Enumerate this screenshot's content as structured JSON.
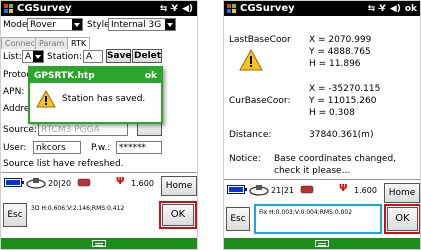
{
  "colors": {
    "titlebar_bg": "#000000",
    "dialog_green": "#2ba52b",
    "keyboard_bar": "#1a8f1a",
    "battery_blue": "#0a32d8",
    "highlight_red": "#d01010",
    "highlight_blue": "#15a7e8"
  },
  "left": {
    "title": "CGSurvey",
    "mode_label": "Mode",
    "mode_value": "Rover",
    "style_label": "Style",
    "style_value": "Internal 3G",
    "tabs": [
      "Connect",
      "Param",
      "RTK"
    ],
    "list_label": "List:",
    "list_value": "A",
    "station_label": "Station:",
    "station_value": "A",
    "save_button": "Save",
    "delete_button": "Delet",
    "protocol_label": "Protoc",
    "apn_label": "APN:",
    "address_label": "Addres",
    "address_value": "8",
    "source_label": "Source:",
    "source_value": "RTCM3 PGGA",
    "user_label": "User:",
    "user_value": "nkcors",
    "pw_label": "P.w.:",
    "pw_value": "******",
    "message": "Source list have refreshed.",
    "sat_count": "20|20",
    "signal_value": "1.600",
    "home_button": "Home",
    "esc_button": "Esc",
    "ok_button": "OK",
    "precision": "3D H:0.606;V:2.146;RMS:0.412",
    "dialog": {
      "title": "GPSRTK.htp",
      "ok": "ok",
      "message": "Station has saved."
    }
  },
  "right": {
    "title": "CGSurvey",
    "ok": "ok",
    "last_base_label": "LastBaseCoor",
    "last_x": "X = 2070.999",
    "last_y": "Y = 4888.765",
    "last_h": "H = 11.896",
    "cur_base_label": "CurBaseCoor:",
    "cur_x": "X = -35270.115",
    "cur_y": "Y = 11015.260",
    "cur_h": "H = 0.308",
    "distance_label": "Distance:",
    "distance_value": "37840.361(m)",
    "notice_label": "Notice:",
    "notice_line1": "Base coordinates changed,",
    "notice_line2": "check it please...",
    "sat_count": "21|21",
    "signal_value": "1.600",
    "home_button": "Home",
    "esc_button": "Esc",
    "ok_button": "OK",
    "precision": "Fix H:0.003;V:0.004;RMS:0.002"
  }
}
